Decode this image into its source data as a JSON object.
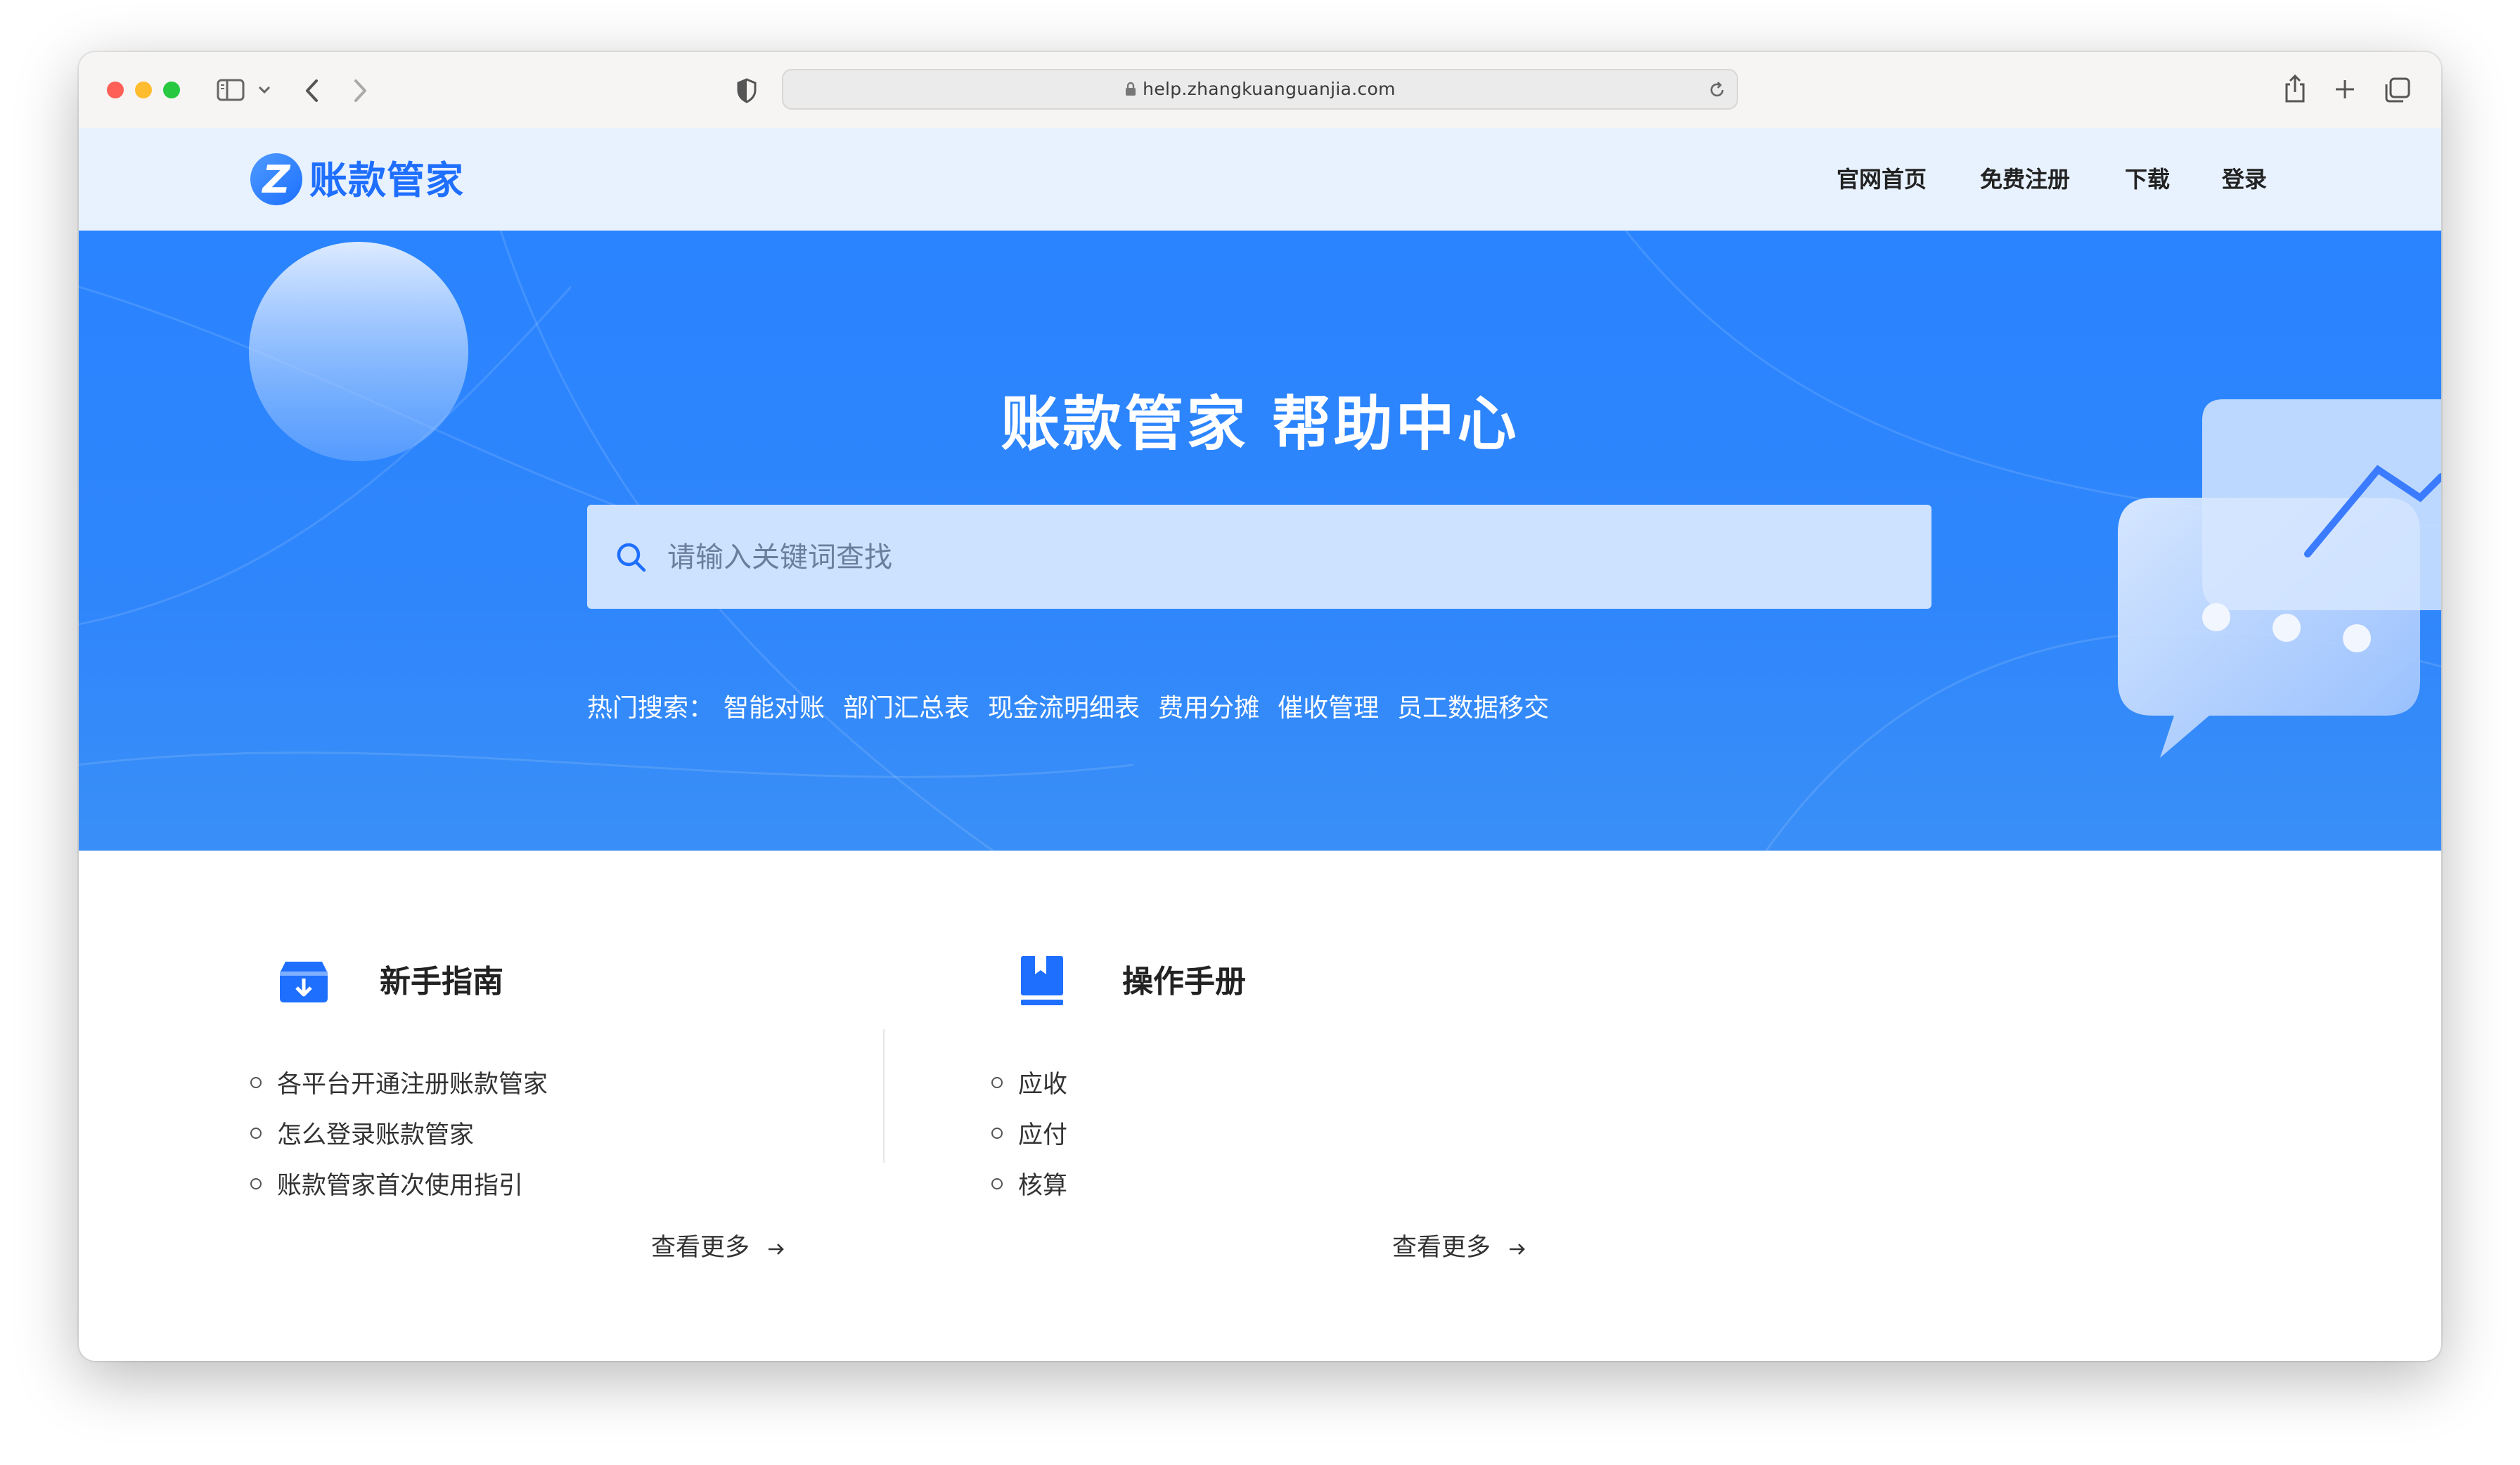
{
  "browser": {
    "url": "help.zhangkuanguanjia.com"
  },
  "header": {
    "logo_letter": "Z",
    "logo_text": "账款管家",
    "nav": [
      "官网首页",
      "免费注册",
      "下载",
      "登录"
    ]
  },
  "hero": {
    "title": "账款管家 帮助中心",
    "search_placeholder": "请输入关键词查找",
    "hot_label": "热门搜索：",
    "hot_terms": [
      "智能对账",
      "部门汇总表",
      "现金流明细表",
      "费用分摊",
      "催收管理",
      "员工数据移交"
    ]
  },
  "sections": [
    {
      "title": "新手指南",
      "icon": "download-box-icon",
      "items": [
        "各平台开通注册账款管家",
        "怎么登录账款管家",
        "账款管家首次使用指引"
      ],
      "more": "查看更多"
    },
    {
      "title": "操作手册",
      "icon": "bookmark-book-icon",
      "items": [
        "应收",
        "应付",
        "核算"
      ],
      "more": "查看更多"
    }
  ],
  "colors": {
    "brand": "#1f6fff",
    "hero_bg": "#2a84ff",
    "header_bg": "#e8f2ff"
  }
}
